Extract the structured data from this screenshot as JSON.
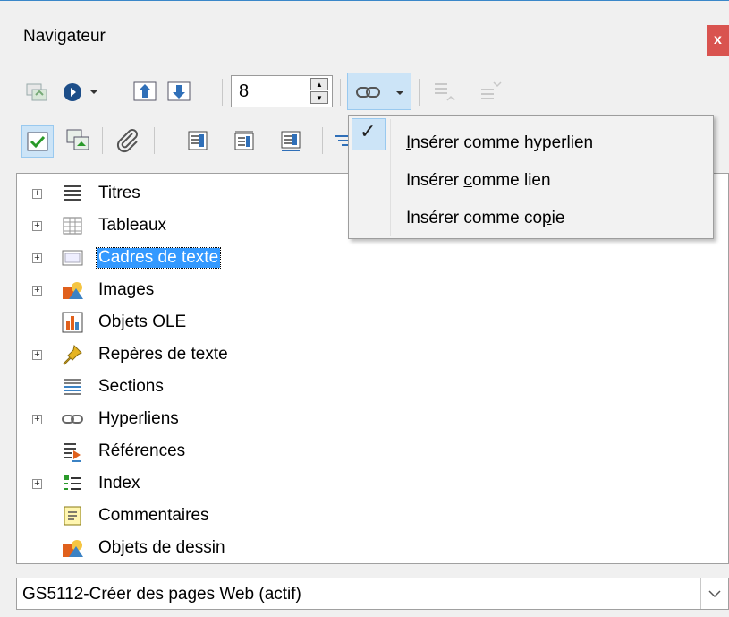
{
  "window": {
    "title": "Navigateur",
    "close_label": "x"
  },
  "toolbar": {
    "spin_value": "8",
    "spin_up": "▲",
    "spin_down": "▼"
  },
  "menu": {
    "check_glyph": "✓",
    "items": [
      {
        "pre": "",
        "key": "I",
        "post": "nsérer comme hyperlien",
        "checked": true
      },
      {
        "pre": "Insérer ",
        "key": "c",
        "post": "omme lien",
        "checked": false
      },
      {
        "pre": "Insérer comme co",
        "key": "p",
        "post": "ie",
        "checked": false
      }
    ]
  },
  "tree": {
    "expander": "+",
    "items": [
      {
        "label": "Titres",
        "icon": "headings-icon",
        "expandable": true
      },
      {
        "label": "Tableaux",
        "icon": "table-icon",
        "expandable": true
      },
      {
        "label": "Cadres de texte",
        "icon": "text-frame-icon",
        "expandable": true,
        "selected": true
      },
      {
        "label": "Images",
        "icon": "image-icon",
        "expandable": true
      },
      {
        "label": "Objets OLE",
        "icon": "ole-object-icon",
        "expandable": false
      },
      {
        "label": "Repères de texte",
        "icon": "bookmark-pin-icon",
        "expandable": true
      },
      {
        "label": "Sections",
        "icon": "sections-icon",
        "expandable": false
      },
      {
        "label": "Hyperliens",
        "icon": "hyperlink-icon",
        "expandable": true
      },
      {
        "label": "Références",
        "icon": "references-icon",
        "expandable": false
      },
      {
        "label": "Index",
        "icon": "index-icon",
        "expandable": true
      },
      {
        "label": "Commentaires",
        "icon": "comment-icon",
        "expandable": false
      },
      {
        "label": "Objets de dessin",
        "icon": "drawing-object-icon",
        "expandable": false
      }
    ]
  },
  "document_select": {
    "value": "GS5112-Créer des pages Web (actif)"
  },
  "colors": {
    "accent": "#3399ff",
    "close": "#d9534f",
    "highlight": "#cce4f7"
  }
}
